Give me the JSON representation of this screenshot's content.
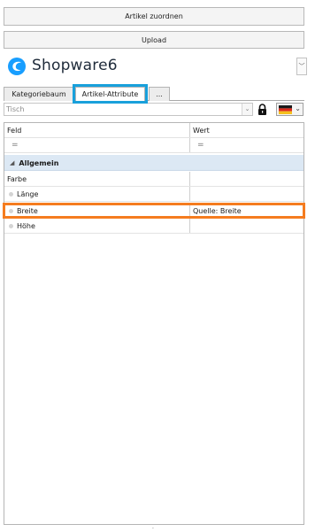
{
  "buttons": {
    "assign": "Artikel zuordnen",
    "upload": "Upload"
  },
  "logo": {
    "text": "Shopware6",
    "dropdown_glyph": "﹀"
  },
  "tabs": [
    {
      "label": "Kategoriebaum"
    },
    {
      "label": "Artikel-Attribute"
    },
    {
      "label": "..."
    }
  ],
  "toolbar": {
    "search_value": "Tisch",
    "dropdown_glyph": "⌄",
    "flag_arrow": "⌄"
  },
  "colors": {
    "tab_highlight": "#19a0db",
    "row_highlight": "#f57c1f",
    "group_bg": "#dce8f4",
    "logo_blue": "#189eff"
  },
  "grid": {
    "headers": {
      "field": "Feld",
      "value": "Wert"
    },
    "filter_symbol": "=",
    "group": {
      "caret": "◢",
      "label": "Allgemein"
    },
    "rows": [
      {
        "field": "Farbe",
        "value": ""
      },
      {
        "field": "Länge",
        "value": ""
      },
      {
        "field": "Breite",
        "value": "Quelle: Breite"
      },
      {
        "field": "Höhe",
        "value": ""
      }
    ]
  },
  "bottom_mark": "·"
}
